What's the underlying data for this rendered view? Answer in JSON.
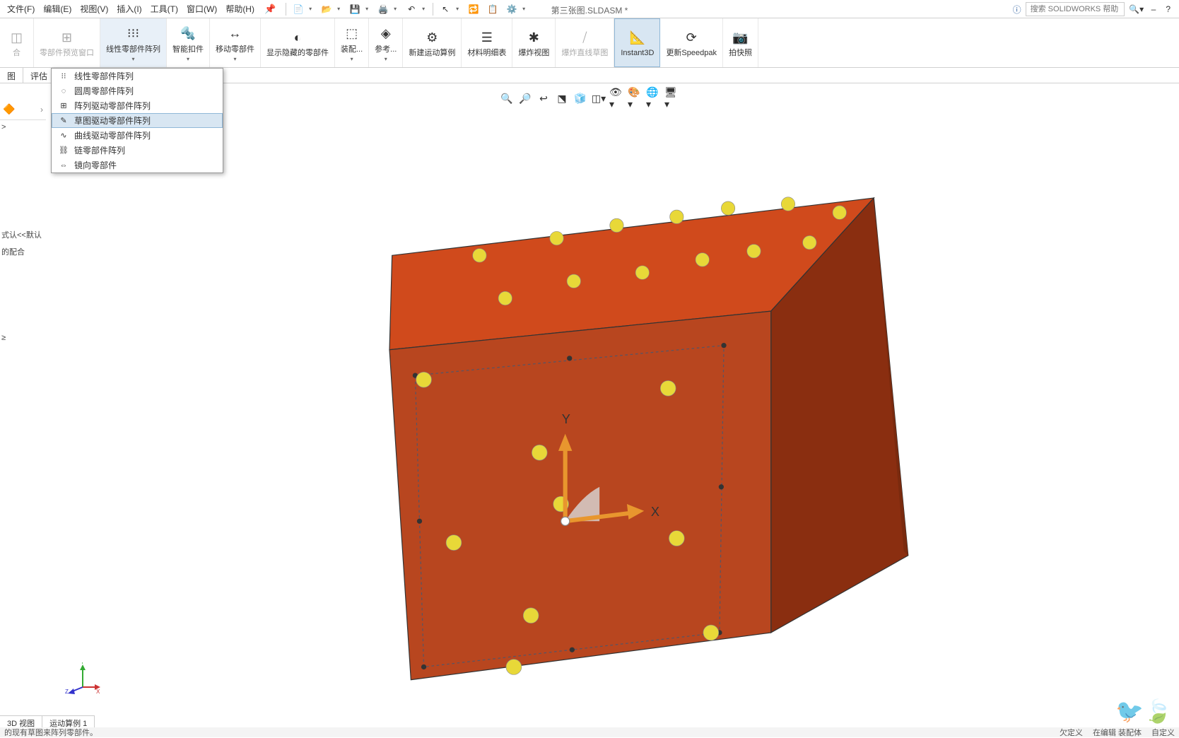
{
  "menubar": {
    "items": [
      "文件(F)",
      "编辑(E)",
      "视图(V)",
      "插入(I)",
      "工具(T)",
      "窗口(W)",
      "帮助(H)"
    ]
  },
  "doc_title": "第三张图.SLDASM *",
  "search": {
    "placeholder": "搜索 SOLIDWORKS 帮助"
  },
  "ribbon": [
    {
      "label": "合",
      "sub": "",
      "disabled": true
    },
    {
      "label": "零部件预览窗口",
      "disabled": true
    },
    {
      "label": "线性零部件阵列"
    },
    {
      "label": "智能扣件"
    },
    {
      "label": "移动零部件"
    },
    {
      "label": "显示隐藏的零部件"
    },
    {
      "label": "装配..."
    },
    {
      "label": "参考..."
    },
    {
      "label": "新建运动算例"
    },
    {
      "label": "材料明细表"
    },
    {
      "label": "爆炸视图"
    },
    {
      "label": "爆炸直线草图",
      "disabled": true
    },
    {
      "label": "Instant3D",
      "active": true
    },
    {
      "label": "更新Speedpak"
    },
    {
      "label": "拍快照"
    }
  ],
  "tabs": [
    "图",
    "评估"
  ],
  "dropdown": [
    "线性零部件阵列",
    "圆周零部件阵列",
    "阵列驱动零部件阵列",
    "草图驱动零部件阵列",
    "曲线驱动零部件阵列",
    "链零部件阵列",
    "镜向零部件"
  ],
  "dropdown_highlighted": 3,
  "tree": {
    "l1": ">",
    "l2": "式认<<默认",
    "l3": "的配合",
    "l4": "≥"
  },
  "bottom_tabs": [
    "3D 视图",
    "运动算例 1"
  ],
  "statusbar": {
    "left": "的现有草图来阵列零部件。",
    "r1": "欠定义",
    "r2": "在编辑 装配体",
    "r3": "自定义"
  },
  "axis": {
    "x": "X",
    "y": "Y",
    "z": "Z"
  }
}
